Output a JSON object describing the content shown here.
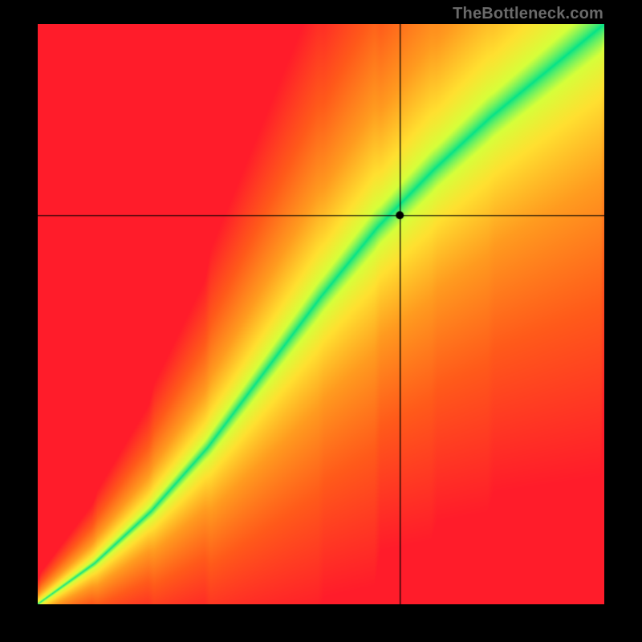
{
  "watermark": "TheBottleneck.com",
  "chart_data": {
    "type": "heatmap",
    "title": "",
    "xlabel": "",
    "ylabel": "",
    "xlim": [
      0,
      100
    ],
    "ylim": [
      0,
      100
    ],
    "crosshair": {
      "x": 64,
      "y": 67
    },
    "marker": {
      "x": 64,
      "y": 67,
      "radius": 5
    },
    "ridge": [
      {
        "x": 0,
        "y": 0
      },
      {
        "x": 10,
        "y": 7
      },
      {
        "x": 20,
        "y": 16
      },
      {
        "x": 30,
        "y": 27
      },
      {
        "x": 40,
        "y": 40
      },
      {
        "x": 50,
        "y": 53
      },
      {
        "x": 60,
        "y": 65
      },
      {
        "x": 70,
        "y": 75
      },
      {
        "x": 80,
        "y": 84
      },
      {
        "x": 90,
        "y": 92
      },
      {
        "x": 100,
        "y": 100
      }
    ],
    "ridge_width_start": 1,
    "ridge_width_end": 20,
    "colorscale": [
      {
        "t": 0.0,
        "color": "#00e28a"
      },
      {
        "t": 0.12,
        "color": "#d6ff3a"
      },
      {
        "t": 0.25,
        "color": "#ffe030"
      },
      {
        "t": 0.45,
        "color": "#ff9b1f"
      },
      {
        "t": 0.7,
        "color": "#ff5a1a"
      },
      {
        "t": 1.0,
        "color": "#ff1c2a"
      }
    ]
  }
}
